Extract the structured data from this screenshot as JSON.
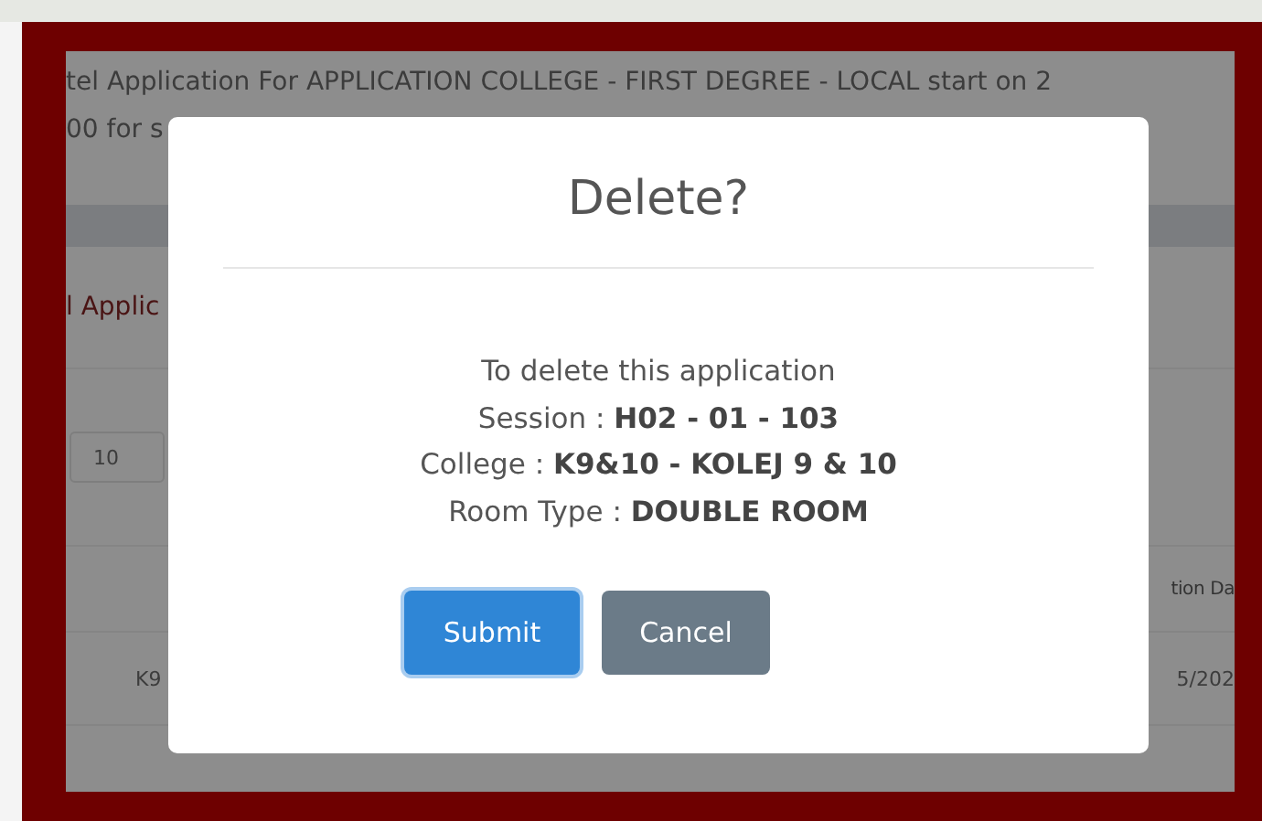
{
  "page": {
    "header_lines": [
      "tel Application For APPLICATION COLLEGE - FIRST DEGREE - LOCAL start on 2",
      "00 for s"
    ],
    "panel_title": "l Applic",
    "page_size": "10",
    "column_header": "tion Da",
    "row_cells": [
      "K9",
      "5/202"
    ]
  },
  "dialog": {
    "title": "Delete?",
    "lines": [
      "To delete this application",
      "Session : **H02 - 01 - 103**",
      "College : **K9&10 - KOLEJ 9 & 10**",
      "Room Type : **DOUBLE ROOM**"
    ],
    "buttons": [
      {
        "label": "Submit",
        "kind": "primary"
      },
      {
        "label": "Cancel",
        "kind": "secondary"
      }
    ]
  }
}
